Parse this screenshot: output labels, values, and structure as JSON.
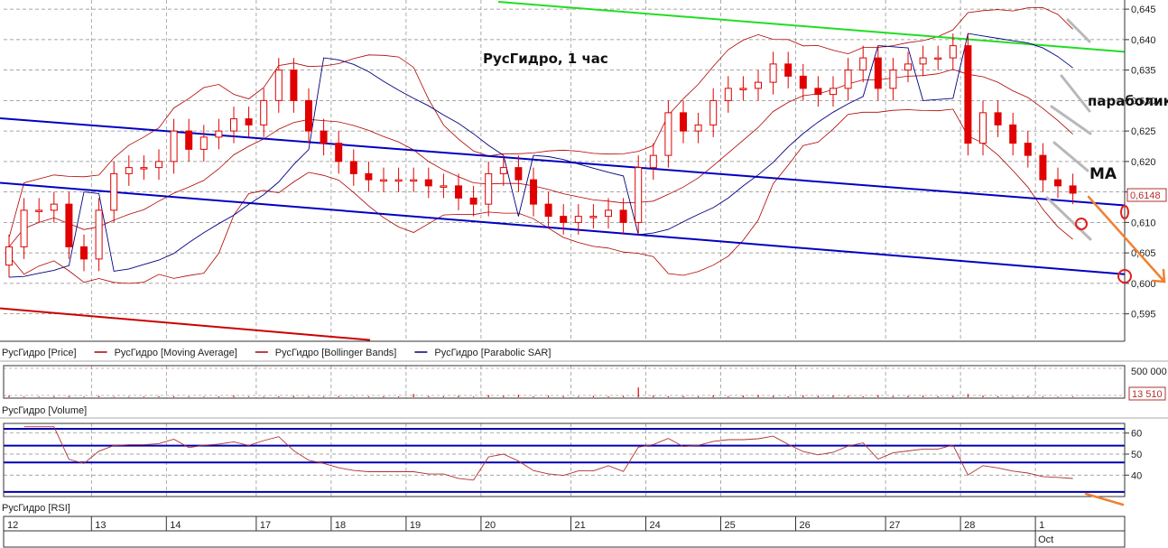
{
  "chart_data": {
    "type": "candlestick",
    "title": "РусГидро, 1 час",
    "price_axis": {
      "ylim": [
        0.5905,
        0.6465
      ],
      "ticks": [
        "0,645",
        "0,640",
        "0,635",
        "0,630",
        "0,625",
        "0,620",
        "0,615",
        "0,610",
        "0,605",
        "0,600",
        "0,595"
      ],
      "tick_values": [
        0.645,
        0.64,
        0.635,
        0.63,
        0.625,
        0.62,
        0.615,
        0.61,
        0.605,
        0.6,
        0.595
      ]
    },
    "last_price": {
      "label": "0,6148",
      "value": 0.6148
    },
    "open": [
      0.603,
      0.606,
      0.612,
      0.612,
      0.613,
      0.606,
      0.604,
      0.612,
      0.618,
      0.619,
      0.619,
      0.62,
      0.625,
      0.622,
      0.624,
      0.625,
      0.627,
      0.626,
      0.63,
      0.635,
      0.63,
      0.625,
      0.623,
      0.62,
      0.618,
      0.617,
      0.617,
      0.617,
      0.617,
      0.616,
      0.616,
      0.614,
      0.613,
      0.618,
      0.619,
      0.617,
      0.613,
      0.611,
      0.61,
      0.611,
      0.611,
      0.612,
      0.61,
      0.619,
      0.621,
      0.628,
      0.625,
      0.626,
      0.63,
      0.632,
      0.632,
      0.633,
      0.636,
      0.634,
      0.632,
      0.631,
      0.632,
      0.635,
      0.637,
      0.632,
      0.635,
      0.636,
      0.637,
      0.637,
      0.639,
      0.623,
      0.628,
      0.626,
      0.623,
      0.621,
      0.617,
      0.616
    ],
    "high": [
      0.608,
      0.614,
      0.614,
      0.615,
      0.615,
      0.608,
      0.614,
      0.62,
      0.621,
      0.621,
      0.622,
      0.627,
      0.627,
      0.626,
      0.627,
      0.629,
      0.629,
      0.632,
      0.637,
      0.637,
      0.632,
      0.627,
      0.625,
      0.622,
      0.62,
      0.619,
      0.619,
      0.619,
      0.619,
      0.618,
      0.618,
      0.616,
      0.62,
      0.621,
      0.621,
      0.619,
      0.615,
      0.613,
      0.613,
      0.613,
      0.614,
      0.614,
      0.621,
      0.623,
      0.63,
      0.63,
      0.628,
      0.632,
      0.634,
      0.634,
      0.635,
      0.638,
      0.638,
      0.636,
      0.634,
      0.634,
      0.637,
      0.639,
      0.639,
      0.637,
      0.638,
      0.639,
      0.639,
      0.641,
      0.641,
      0.63,
      0.63,
      0.628,
      0.625,
      0.623,
      0.619,
      0.618
    ],
    "low": [
      0.601,
      0.604,
      0.61,
      0.61,
      0.604,
      0.602,
      0.602,
      0.61,
      0.616,
      0.617,
      0.617,
      0.618,
      0.62,
      0.62,
      0.622,
      0.623,
      0.624,
      0.624,
      0.628,
      0.628,
      0.623,
      0.621,
      0.618,
      0.616,
      0.615,
      0.615,
      0.615,
      0.615,
      0.614,
      0.614,
      0.612,
      0.611,
      0.611,
      0.616,
      0.615,
      0.611,
      0.609,
      0.608,
      0.608,
      0.609,
      0.609,
      0.608,
      0.608,
      0.617,
      0.619,
      0.623,
      0.623,
      0.624,
      0.628,
      0.63,
      0.63,
      0.631,
      0.632,
      0.63,
      0.629,
      0.629,
      0.63,
      0.633,
      0.63,
      0.63,
      0.633,
      0.634,
      0.635,
      0.635,
      0.621,
      0.621,
      0.624,
      0.621,
      0.619,
      0.615,
      0.614,
      0.613
    ],
    "close": [
      0.606,
      0.612,
      0.612,
      0.613,
      0.606,
      0.604,
      0.612,
      0.618,
      0.619,
      0.619,
      0.62,
      0.625,
      0.622,
      0.624,
      0.625,
      0.627,
      0.626,
      0.63,
      0.635,
      0.63,
      0.625,
      0.623,
      0.62,
      0.618,
      0.617,
      0.617,
      0.617,
      0.617,
      0.616,
      0.616,
      0.614,
      0.613,
      0.618,
      0.619,
      0.617,
      0.613,
      0.611,
      0.61,
      0.611,
      0.611,
      0.612,
      0.61,
      0.619,
      0.621,
      0.628,
      0.625,
      0.626,
      0.63,
      0.632,
      0.632,
      0.633,
      0.636,
      0.634,
      0.632,
      0.631,
      0.632,
      0.635,
      0.637,
      0.632,
      0.635,
      0.636,
      0.637,
      0.637,
      0.639,
      0.623,
      0.628,
      0.626,
      0.623,
      0.621,
      0.617,
      0.616,
      0.6148
    ],
    "volume": [
      30000,
      15000,
      12000,
      18000,
      22000,
      14000,
      25000,
      12000,
      10000,
      15000,
      20000,
      18000,
      14000,
      12000,
      16000,
      30000,
      12000,
      14000,
      18000,
      25000,
      16000,
      14000,
      22000,
      12000,
      14000,
      18000,
      15000,
      60000,
      20000,
      16000,
      30000,
      14000,
      40000,
      25000,
      45000,
      18000,
      30000,
      20000,
      14000,
      25000,
      18000,
      22000,
      180000,
      30000,
      20000,
      25000,
      18000,
      35000,
      20000,
      30000,
      40000,
      25000,
      18000,
      35000,
      22000,
      30000,
      25000,
      18000,
      40000,
      20000,
      25000,
      30000,
      18000,
      22000,
      60000,
      30000,
      20000,
      15000,
      18000,
      14000,
      12000,
      13510
    ],
    "volume_axis": {
      "ylim": [
        0,
        500000
      ],
      "top_label": "500 000",
      "last_label": "13 510"
    },
    "rsi_axis": {
      "ylim": [
        29.8,
        64.6
      ],
      "ticks": [
        "60",
        "50",
        "40"
      ],
      "tick_values": [
        60,
        50,
        40
      ],
      "levels": [
        62,
        54,
        46,
        32
      ]
    },
    "days": [
      {
        "label": "12",
        "bar": 0
      },
      {
        "label": "13",
        "bar": 6
      },
      {
        "label": "14",
        "bar": 11
      },
      {
        "label": "17",
        "bar": 17
      },
      {
        "label": "18",
        "bar": 22
      },
      {
        "label": "19",
        "bar": 27
      },
      {
        "label": "20",
        "bar": 32
      },
      {
        "label": "21",
        "bar": 38
      },
      {
        "label": "24",
        "bar": 43
      },
      {
        "label": "25",
        "bar": 48
      },
      {
        "label": "26",
        "bar": 53
      },
      {
        "label": "27",
        "bar": 59
      },
      {
        "label": "28",
        "bar": 64
      },
      {
        "label": "1",
        "bar": 69
      }
    ],
    "month_label": {
      "label": "Oct",
      "bar": 69
    },
    "trend_lines": [
      {
        "color": "#22dd22",
        "from": {
          "bar": 32.65,
          "price": 0.6462
        },
        "to": {
          "bar": 74.46,
          "price": 0.638
        }
      },
      {
        "color": "#0000c0",
        "from": {
          "bar": -0.6,
          "price": 0.6271
        },
        "to": {
          "bar": 74.46,
          "price": 0.6128
        }
      },
      {
        "color": "#0000c0",
        "from": {
          "bar": -0.6,
          "price": 0.6165
        },
        "to": {
          "bar": 74.46,
          "price": 0.6015
        }
      },
      {
        "color": "#cc0000",
        "from": {
          "bar": -0.6,
          "price": 0.5959
        },
        "to": {
          "bar": 24.1,
          "price": 0.5907
        }
      }
    ],
    "legend": [
      {
        "label": "РусГидро [Price]",
        "color": ""
      },
      {
        "label": "РусГидро [Moving Average]",
        "color": "#b00000"
      },
      {
        "label": "РусГидро [Bollinger Bands]",
        "color": "#b00000"
      },
      {
        "label": "РусГидро [Parabolic SAR]",
        "color": "#000080"
      }
    ],
    "volume_label": "РусГидро [Volume]",
    "rsi_label": "РусГидро [RSI]",
    "annotations": {
      "parabolic": "параболик",
      "ma": "MA"
    },
    "colors": {
      "candle": "#e00000",
      "ma": "#b00000",
      "bands": "#b00000",
      "sar": "#000080",
      "rsi": "#b03030",
      "rsi_levels": "#0000b0",
      "arrow": "#f08030"
    }
  }
}
